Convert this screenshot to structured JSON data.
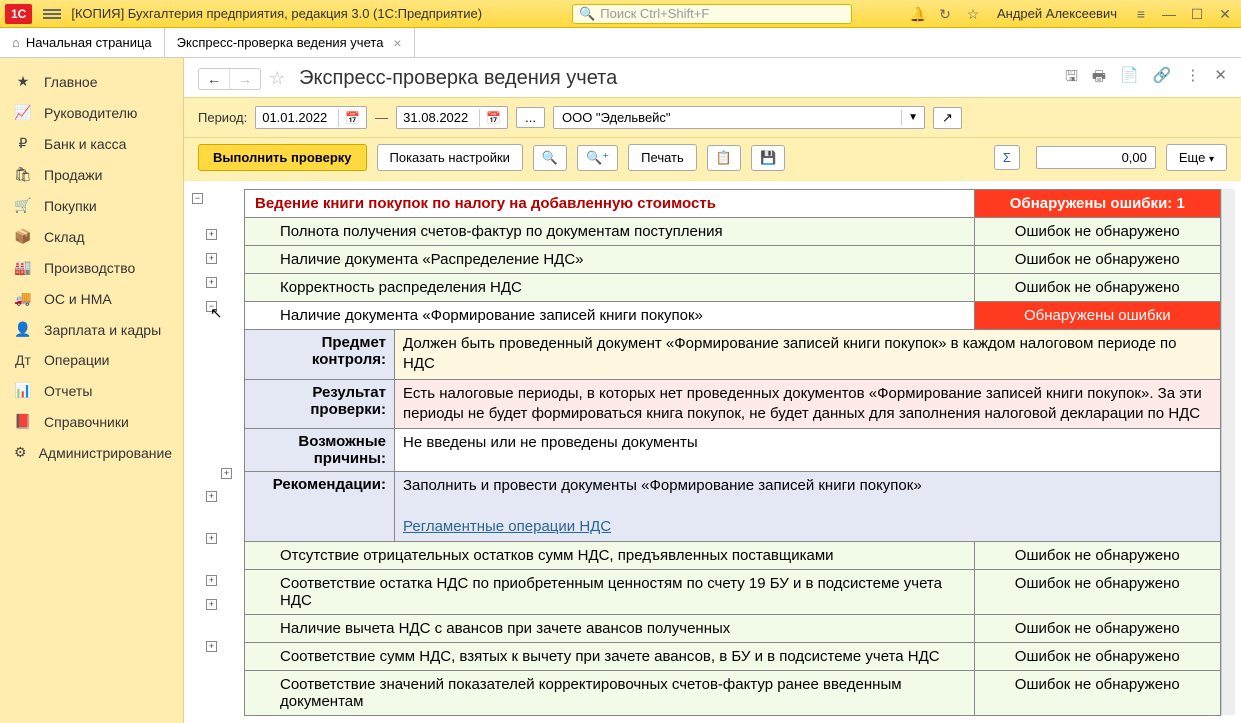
{
  "title": "[КОПИЯ] Бухгалтерия предприятия, редакция 3.0  (1С:Предприятие)",
  "searchPlaceholder": "Поиск Ctrl+Shift+F",
  "user": "Андрей Алексеевич",
  "tabs": {
    "home": "Начальная страница",
    "current": "Экспресс-проверка ведения учета"
  },
  "sidebar": {
    "items": [
      {
        "icon": "★",
        "label": "Главное"
      },
      {
        "icon": "📈",
        "label": "Руководителю"
      },
      {
        "icon": "₽",
        "label": "Банк и касса"
      },
      {
        "icon": "🛍",
        "label": "Продажи"
      },
      {
        "icon": "🛒",
        "label": "Покупки"
      },
      {
        "icon": "📦",
        "label": "Склад"
      },
      {
        "icon": "🏭",
        "label": "Производство"
      },
      {
        "icon": "🚚",
        "label": "ОС и НМА"
      },
      {
        "icon": "👤",
        "label": "Зарплата и кадры"
      },
      {
        "icon": "Дт",
        "label": "Операции"
      },
      {
        "icon": "📊",
        "label": "Отчеты"
      },
      {
        "icon": "📕",
        "label": "Справочники"
      },
      {
        "icon": "⚙",
        "label": "Администрирование"
      }
    ]
  },
  "page": {
    "title": "Экспресс-проверка ведения учета",
    "periodLabel": "Период:",
    "dateFrom": "01.01.2022",
    "dateTo": "31.08.2022",
    "dots": "...",
    "org": "ООО \"Эдельвейс\"",
    "btnRun": "Выполнить проверку",
    "btnSettings": "Показать настройки",
    "btnPrint": "Печать",
    "btnMore": "Еще",
    "sumValue": "0,00"
  },
  "report": {
    "sectionTitle": "Ведение книги покупок по налогу на добавленную стоимость",
    "sectionStatus": "Обнаружены ошибки: 1",
    "okText": "Ошибок не обнаружено",
    "errText": "Обнаружены ошибки",
    "rows": [
      "Полнота получения счетов-фактур по документам поступления",
      "Наличие документа «Распределение НДС»",
      "Корректность распределения НДС",
      "Наличие документа «Формирование записей книги покупок»",
      "Отсутствие отрицательных остатков сумм НДС, предъявленных поставщиками",
      "Соответствие остатка НДС по приобретенным ценностям по счету 19 БУ и в подсистеме учета НДС",
      "Наличие вычета НДС с авансов при зачете авансов полученных",
      "Соответствие сумм НДС, взятых к вычету при зачете авансов, в БУ и в подсистеме учета НДС",
      "Соответствие значений показателей корректировочных счетов-фактур ранее введенным документам"
    ],
    "details": {
      "l1": "Предмет контроля:",
      "v1": "Должен быть проведенный документ «Формирование записей книги покупок» в каждом налоговом периоде по НДС",
      "l2": "Результат проверки:",
      "v2": "Есть налоговые периоды, в которых нет проведенных документов «Формирование записей книги покупок». За эти периоды не будет формироваться книга покупок, не будет данных для заполнения налоговой декларации по НДС",
      "l3": "Возможные причины:",
      "v3": "Не введены или не проведены документы",
      "l4": "Рекомендации:",
      "v4": "Заполнить и провести документы «Формирование записей книги покупок»",
      "link": "Регламентные операции НДС"
    }
  }
}
